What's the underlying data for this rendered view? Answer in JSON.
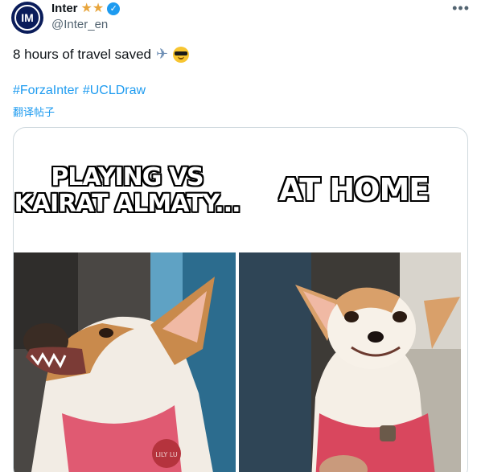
{
  "account": {
    "name": "Inter",
    "handle": "@Inter_en",
    "stars": "★★",
    "verified_mark": "✓",
    "more_label": "•••"
  },
  "tweet": {
    "text": "8 hours of travel saved",
    "emoji_plane": "✈",
    "hashtags": [
      "#ForzaInter",
      "#UCLDraw"
    ],
    "translate_label": "翻译帖子"
  },
  "media": {
    "left_caption": [
      "PLAYING VS",
      "KAIRAT ALMATY..."
    ],
    "right_caption": "AT HOME",
    "left_tag_text": "LILY LU"
  },
  "colors": {
    "accent": "#1d9bf0",
    "avatar_bg": "#0a1c5a",
    "star": "#e8a53c"
  }
}
